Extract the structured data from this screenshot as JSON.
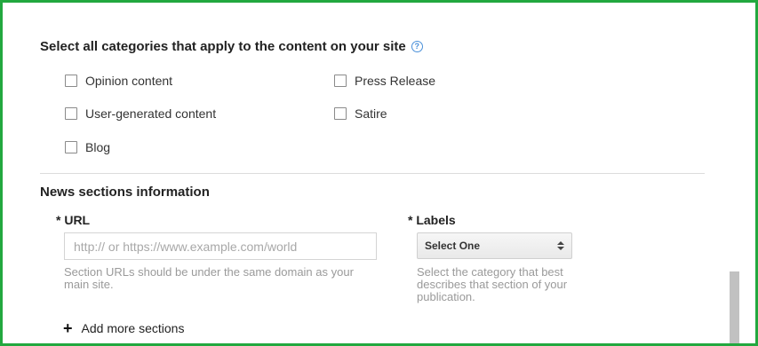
{
  "categories": {
    "heading": "Select all categories that apply to the content on your site",
    "help_icon": "?",
    "options": [
      {
        "label": "Opinion content"
      },
      {
        "label": "Press Release"
      },
      {
        "label": "User-generated content"
      },
      {
        "label": "Satire"
      },
      {
        "label": "Blog"
      }
    ]
  },
  "news_sections": {
    "title": "News sections information",
    "url": {
      "label": "* URL",
      "placeholder": "http:// or https://www.example.com/world",
      "help": "Section URLs should be under the same domain as your main site."
    },
    "labels": {
      "label": "* Labels",
      "selected": "Select One",
      "help": "Select the category that best describes that section of your publication."
    },
    "add_more": {
      "icon": "+",
      "label": "Add more sections"
    }
  }
}
